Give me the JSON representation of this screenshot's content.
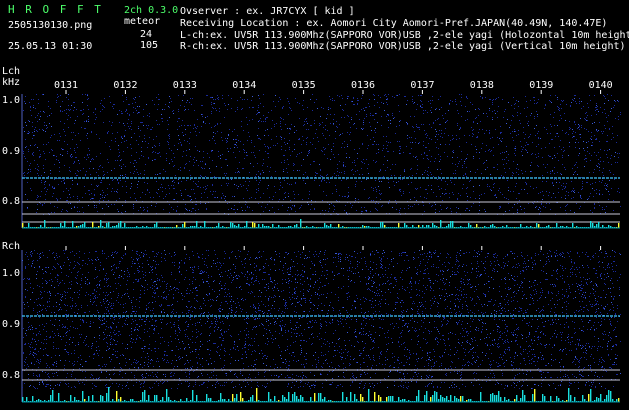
{
  "header": {
    "app_name": "H R O F F T",
    "version": "2ch 0.3.0",
    "filename": "2505130130.png",
    "mode": "meteor",
    "count_l": "24",
    "datetime": "25.05.13 01:30",
    "count_r": "105",
    "observer": "Ovserver            : ex. JR7CYX [ kid ]",
    "location": "Receiving Location : ex. Aomori City Aomori-Pref.JAPAN(40.49N, 140.47E)",
    "lch_info": "L-ch:ex. UV5R 113.900Mhz(SAPPORO VOR)USB ,2-ele yagi (Holozontal 10m height",
    "rch_info": "R-ch:ex. UV5R 113.900Mhz(SAPPORO VOR)USB ,2-ele yagi (Vertical 10m height)"
  },
  "lch": {
    "label": "Lch",
    "unit": "kHz",
    "y_ticks": [
      "1.0",
      "0.9",
      "0.8"
    ]
  },
  "rch": {
    "label": "Rch",
    "y_ticks": [
      "1.0",
      "0.9",
      "0.8"
    ]
  },
  "time_ticks": [
    "0131",
    "0132",
    "0133",
    "0134",
    "0135",
    "0136",
    "0137",
    "0138",
    "0139",
    "0140"
  ],
  "colors": {
    "background": "#000000",
    "noise": "#1a2a9a",
    "carrier": "#40c8ff",
    "bars_cyan": "#19e0e0",
    "bars_yellow": "#ffff30",
    "header_green": "#4cff6a"
  }
}
